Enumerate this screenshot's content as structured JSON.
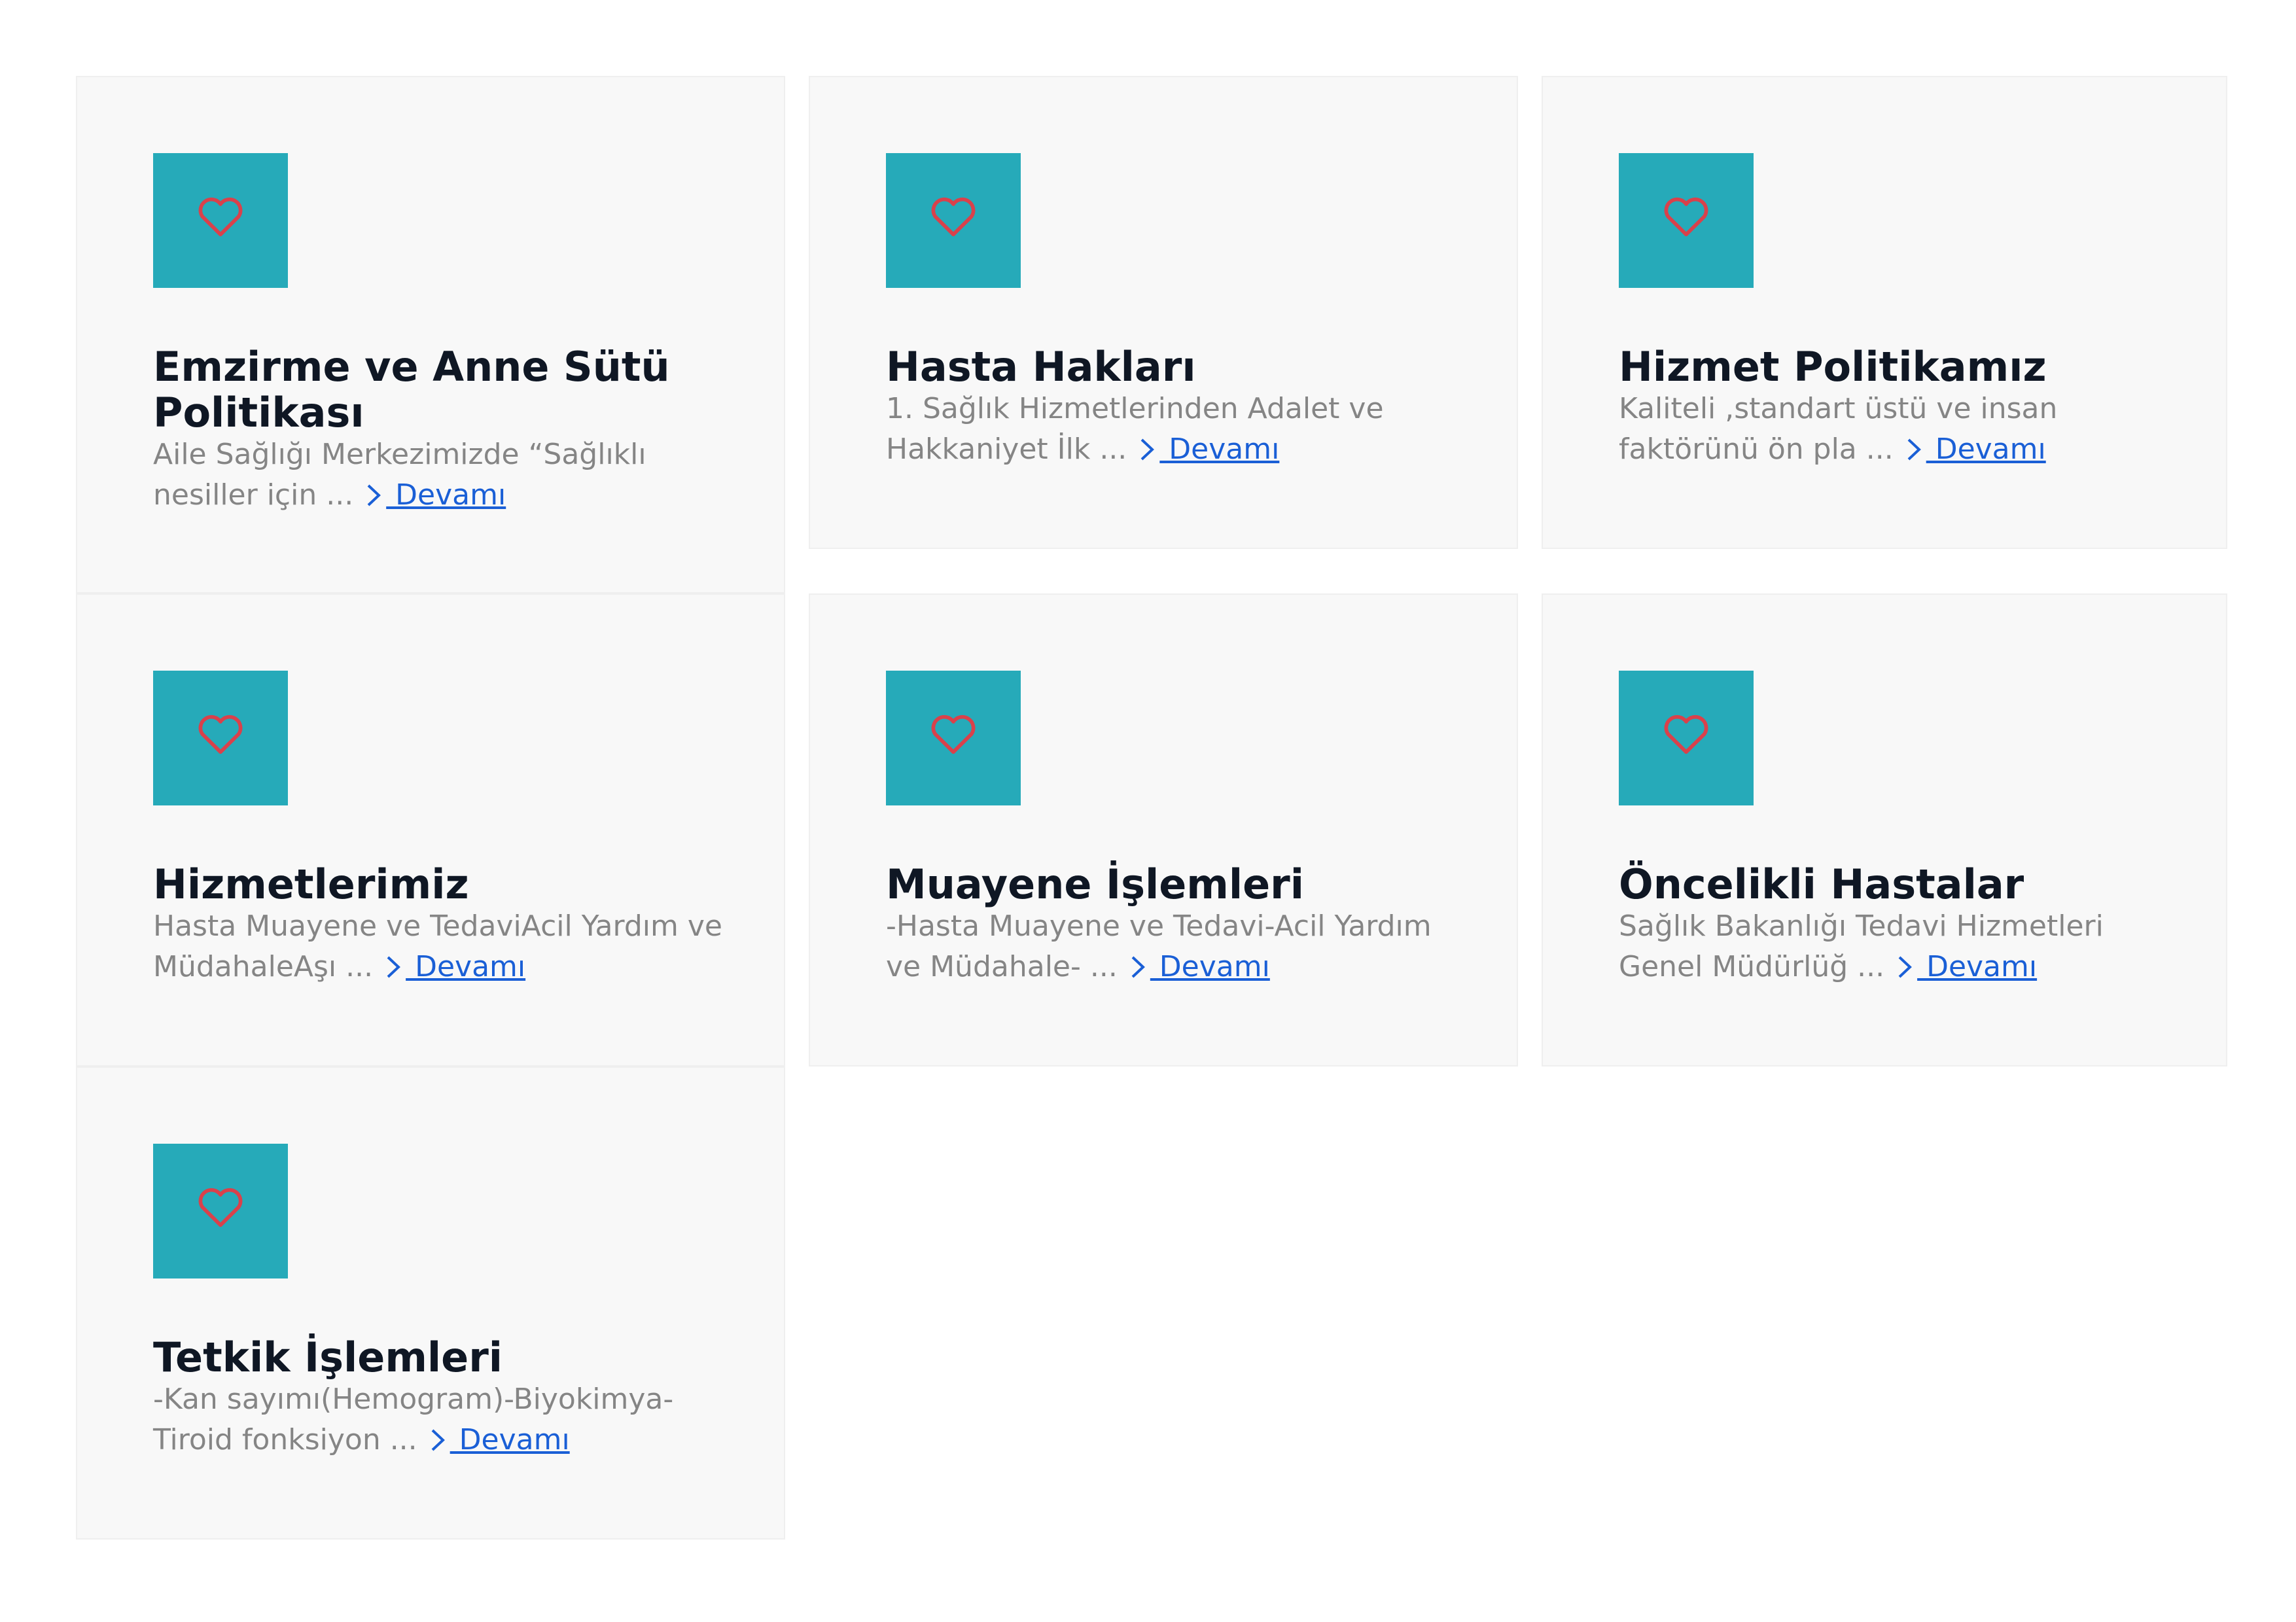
{
  "colors": {
    "card_bg": "#f8f8f8",
    "icon_bg": "#26aab9",
    "heart": "#d9414b",
    "title": "#0f1724",
    "excerpt": "#858585",
    "link": "#1a5fd6"
  },
  "icon": "heart-icon",
  "more_label": " Devamı",
  "cards": [
    {
      "title": "Emzirme ve Anne Sütü Politikası",
      "excerpt": "Aile Sağlığı Merkezimizde “Sağlıklı nesiller için ...",
      "more": " Devamı"
    },
    {
      "title": "Hasta Hakları",
      "excerpt": "1. Sağlık Hizmetlerinden Adalet ve Hakkaniyet İlk ...",
      "more": " Devamı"
    },
    {
      "title": "Hizmet Politikamız",
      "excerpt": "Kaliteli ,standart üstü ve insan faktörünü ön pla ...",
      "more": " Devamı"
    },
    {
      "title": "Hizmetlerimiz",
      "excerpt": "Hasta Muayene ve TedaviAcil Yardım ve MüdahaleAşı ...",
      "more": " Devamı"
    },
    {
      "title": "Muayene İşlemleri",
      "excerpt": "-Hasta Muayene ve Tedavi-Acil Yardım ve Müdahale- ...",
      "more": " Devamı"
    },
    {
      "title": "Öncelikli Hastalar",
      "excerpt": "Sağlık Bakanlığı Tedavi Hizmetleri Genel Müdürlüğ ...",
      "more": " Devamı"
    },
    {
      "title": "Tetkik İşlemleri",
      "excerpt": "-Kan sayımı(Hemogram)-Biyokimya-Tiroid fonksiyon ...",
      "more": " Devamı"
    }
  ]
}
